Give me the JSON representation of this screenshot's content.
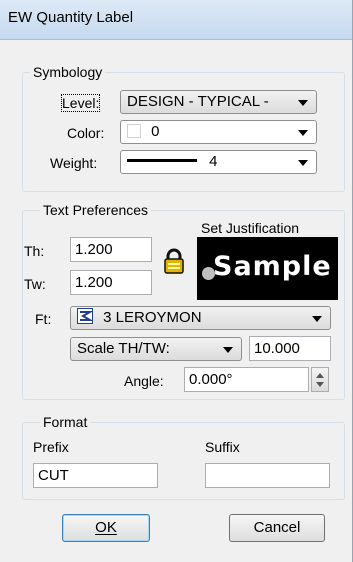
{
  "window": {
    "title": "EW Quantity Label"
  },
  "symbology": {
    "legend": "Symbology",
    "level_label": "Level:",
    "level_value": "DESIGN - TYPICAL -",
    "color_label": "Color:",
    "color_value": "0",
    "weight_label": "Weight:",
    "weight_value": "4"
  },
  "text_prefs": {
    "legend": "Text Preferences",
    "set_justification": "Set Justification",
    "th_label": "Th:",
    "th_value": "1.200",
    "tw_label": "Tw:",
    "tw_value": "1.200",
    "sample_text": "Sample",
    "ft_label": "Ft:",
    "ft_value": "3 LEROYMON",
    "scale_option": "Scale TH/TW:",
    "scale_value": "10.000",
    "angle_label": "Angle:",
    "angle_value": "0.000°"
  },
  "format": {
    "legend": "Format",
    "prefix_label": "Prefix",
    "prefix_value": "CUT",
    "suffix_label": "Suffix",
    "suffix_value": ""
  },
  "buttons": {
    "ok_label": "OK",
    "cancel_label": "Cancel"
  },
  "colors": {
    "accent_default_button": "#3c7fb1",
    "lock_gold": "#e2b400",
    "sample_bg": "#000000"
  },
  "icons": [
    "lock-icon",
    "font-type-icon",
    "spinner-icon",
    "dropdown-arrow-icon"
  ]
}
